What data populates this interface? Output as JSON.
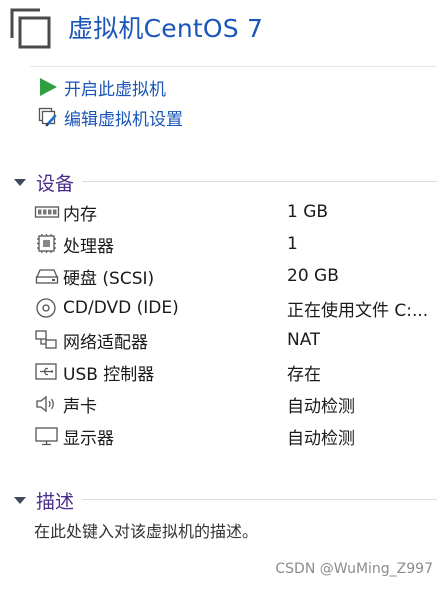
{
  "vm": {
    "title": "虚拟机CentOS 7"
  },
  "actions": {
    "power_on": {
      "label": "开启此虚拟机",
      "icon": "play-icon"
    },
    "edit_settings": {
      "label": "编辑虚拟机设置",
      "icon": "edit-settings-icon"
    }
  },
  "devices_section": {
    "title": "设备",
    "items": [
      {
        "name": "内存",
        "value": "1 GB",
        "icon": "memory-icon"
      },
      {
        "name": "处理器",
        "value": "1",
        "icon": "processor-icon"
      },
      {
        "name": "硬盘 (SCSI)",
        "value": "20 GB",
        "icon": "hard-disk-icon"
      },
      {
        "name": "CD/DVD (IDE)",
        "value": "正在使用文件 C:...",
        "icon": "cd-dvd-icon"
      },
      {
        "name": "网络适配器",
        "value": "NAT",
        "icon": "network-adapter-icon"
      },
      {
        "name": "USB 控制器",
        "value": "存在",
        "icon": "usb-icon"
      },
      {
        "name": "声卡",
        "value": "自动检测",
        "icon": "speaker-icon"
      },
      {
        "name": "显示器",
        "value": "自动检测",
        "icon": "display-icon"
      }
    ]
  },
  "description_section": {
    "title": "描述",
    "placeholder": "在此处键入对该虚拟机的描述。"
  },
  "watermark": "CSDN @WuMing_Z997",
  "colors": {
    "link": "#1a56b8",
    "section_title": "#4a2d8c",
    "play_green": "#2ea043"
  }
}
